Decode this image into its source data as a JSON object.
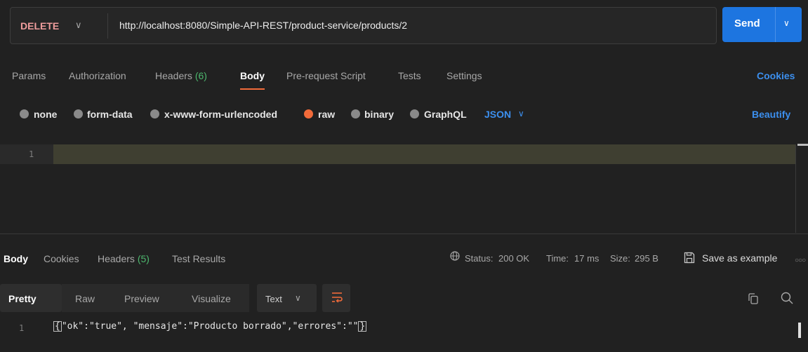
{
  "request": {
    "method": "DELETE",
    "url": "http://localhost:8080/Simple-API-REST/product-service/products/2",
    "send_label": "Send"
  },
  "request_tabs": {
    "params": "Params",
    "authorization": "Authorization",
    "headers": "Headers",
    "headers_count": "(6)",
    "body": "Body",
    "prerequest": "Pre-request Script",
    "tests": "Tests",
    "settings": "Settings",
    "cookies": "Cookies"
  },
  "body_types": {
    "none": "none",
    "form_data": "form-data",
    "urlencoded": "x-www-form-urlencoded",
    "raw": "raw",
    "binary": "binary",
    "graphql": "GraphQL",
    "language": "JSON",
    "beautify": "Beautify",
    "selected": "raw"
  },
  "editor": {
    "line_number": "1",
    "content": ""
  },
  "response_tabs": {
    "body": "Body",
    "cookies": "Cookies",
    "headers": "Headers",
    "headers_count": "(5)",
    "test_results": "Test Results"
  },
  "response_meta": {
    "status_label": "Status:",
    "status_value": "200 OK",
    "time_label": "Time:",
    "time_value": "17 ms",
    "size_label": "Size:",
    "size_value": "295 B",
    "save_example": "Save as example"
  },
  "format_tabs": {
    "pretty": "Pretty",
    "raw": "Raw",
    "preview": "Preview",
    "visualize": "Visualize",
    "text_mode": "Text"
  },
  "response_body": {
    "line_number": "1",
    "open_brace": "{",
    "content": "\"ok\":\"true\", \"mensaje\":\"Producto borrado\",\"errores\":\"\"",
    "close_brace": "}"
  },
  "colors": {
    "accent_orange": "#f26b3a",
    "link_blue": "#3c8fee",
    "send_blue": "#1d75e0",
    "status_green": "#4db86e",
    "method_red": "#f09d9d"
  }
}
